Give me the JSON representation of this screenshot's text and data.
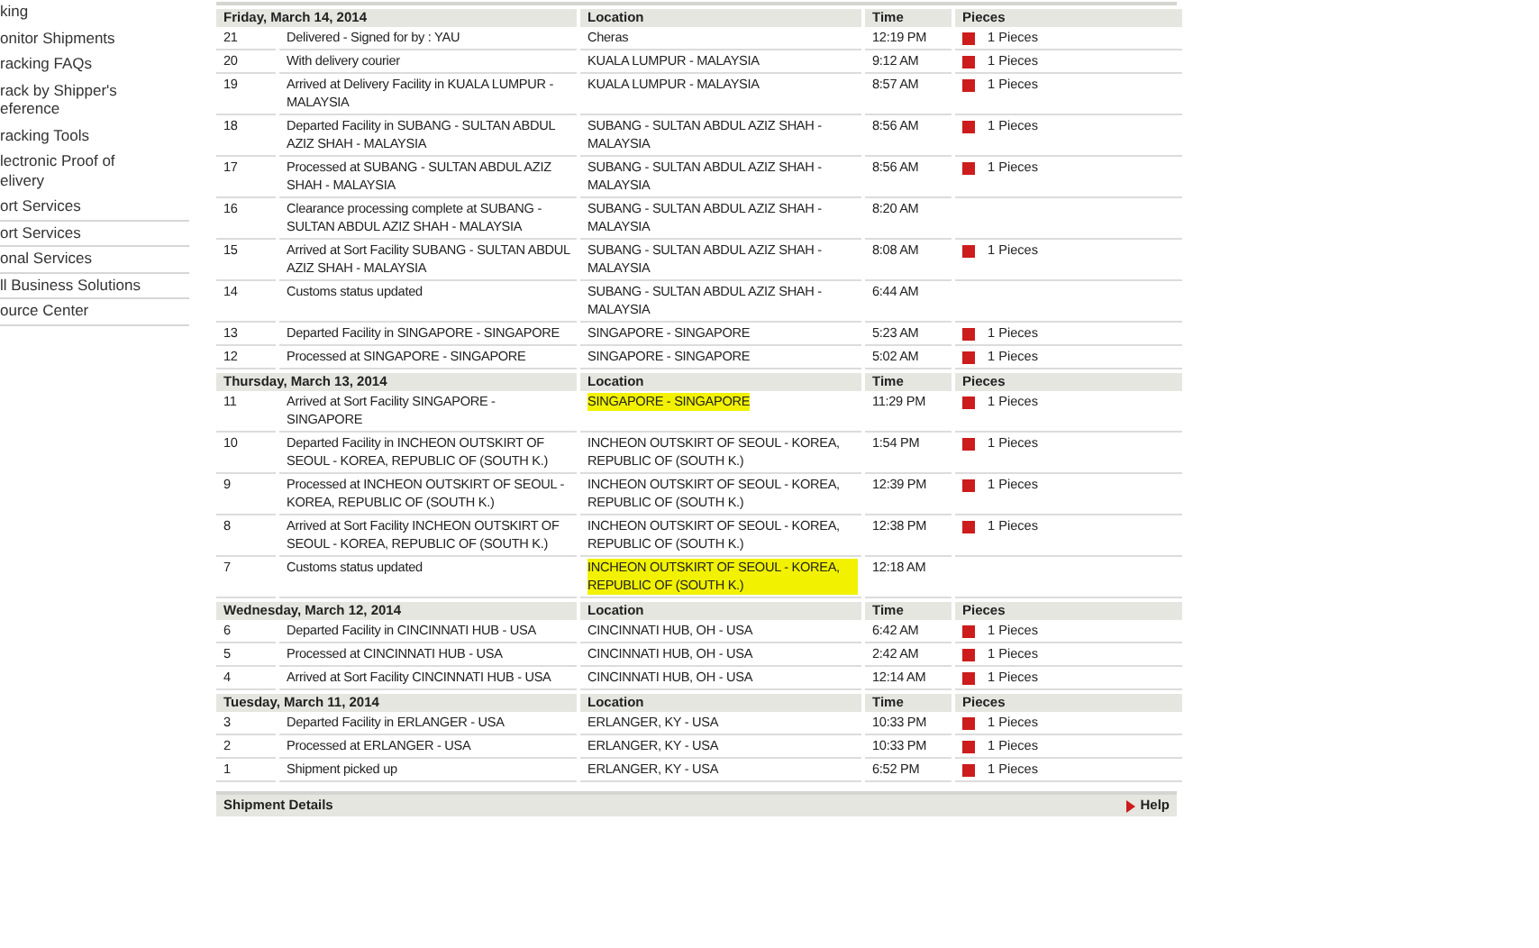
{
  "sidebar": {
    "items": [
      {
        "lines": [
          "king"
        ],
        "divider": false
      },
      {
        "lines": [
          "onitor Shipments"
        ],
        "divider": false
      },
      {
        "lines": [
          "racking FAQs"
        ],
        "divider": false
      },
      {
        "lines": [
          "rack by Shipper's",
          "eference"
        ],
        "divider": false
      },
      {
        "lines": [
          "racking Tools"
        ],
        "divider": false
      },
      {
        "lines": [
          "lectronic Proof of",
          "elivery"
        ],
        "divider": false
      },
      {
        "lines": [
          "ort Services"
        ],
        "divider": true
      },
      {
        "lines": [
          "ort Services"
        ],
        "divider": true
      },
      {
        "lines": [
          "onal Services"
        ],
        "divider": true
      },
      {
        "lines": [
          "ll Business Solutions"
        ],
        "divider": true
      },
      {
        "lines": [
          "ource Center"
        ],
        "divider": true
      }
    ]
  },
  "days": [
    {
      "date": "Friday, March 14, 2014",
      "columns": [
        "Location",
        "Time",
        "Pieces"
      ],
      "events": [
        {
          "number": "21",
          "description": "Delivered - Signed for by : YAU",
          "location": "Cheras",
          "highlighted": false,
          "time": "12:19 PM",
          "pieces": "1 Pieces"
        },
        {
          "number": "20",
          "description": "With delivery courier",
          "location": "KUALA LUMPUR - MALAYSIA",
          "highlighted": false,
          "time": "9:12 AM",
          "pieces": "1 Pieces"
        },
        {
          "number": "19",
          "description": "Arrived at Delivery Facility in KUALA LUMPUR - MALAYSIA",
          "location": "KUALA LUMPUR - MALAYSIA",
          "highlighted": false,
          "time": "8:57 AM",
          "pieces": "1 Pieces"
        },
        {
          "number": "18",
          "description": "Departed Facility in SUBANG - SULTAN ABDUL AZIZ SHAH - MALAYSIA",
          "location": "SUBANG - SULTAN ABDUL AZIZ SHAH - MALAYSIA",
          "highlighted": false,
          "time": "8:56 AM",
          "pieces": "1 Pieces"
        },
        {
          "number": "17",
          "description": "Processed at SUBANG - SULTAN ABDUL AZIZ SHAH - MALAYSIA",
          "location": "SUBANG - SULTAN ABDUL AZIZ SHAH - MALAYSIA",
          "highlighted": false,
          "time": "8:56 AM",
          "pieces": "1 Pieces"
        },
        {
          "number": "16",
          "description": "Clearance processing complete at SUBANG - SULTAN ABDUL AZIZ SHAH - MALAYSIA",
          "location": "SUBANG - SULTAN ABDUL AZIZ SHAH - MALAYSIA",
          "highlighted": false,
          "time": "8:20 AM"
        },
        {
          "number": "15",
          "description": "Arrived at Sort Facility SUBANG - SULTAN ABDUL AZIZ SHAH - MALAYSIA",
          "location": "SUBANG - SULTAN ABDUL AZIZ SHAH - MALAYSIA",
          "highlighted": false,
          "time": "8:08 AM",
          "pieces": "1 Pieces"
        },
        {
          "number": "14",
          "description": "Customs status updated",
          "location": "SUBANG - SULTAN ABDUL AZIZ SHAH - MALAYSIA",
          "highlighted": false,
          "time": "6:44 AM"
        },
        {
          "number": "13",
          "description": "Departed Facility in SINGAPORE - SINGAPORE",
          "location": "SINGAPORE - SINGAPORE",
          "highlighted": false,
          "time": "5:23 AM",
          "pieces": "1 Pieces"
        },
        {
          "number": "12",
          "description": "Processed at SINGAPORE - SINGAPORE",
          "location": "SINGAPORE - SINGAPORE",
          "highlighted": false,
          "time": "5:02 AM",
          "pieces": "1 Pieces"
        }
      ]
    },
    {
      "date": "Thursday, March 13, 2014",
      "columns": [
        "Location",
        "Time",
        "Pieces"
      ],
      "events": [
        {
          "number": "11",
          "description": "Arrived at Sort Facility SINGAPORE - SINGAPORE",
          "location": "SINGAPORE - SINGAPORE",
          "highlighted": true,
          "time": "11:29 PM",
          "pieces": "1 Pieces"
        },
        {
          "number": "10",
          "description": "Departed Facility in INCHEON OUTSKIRT OF SEOUL - KOREA, REPUBLIC OF (SOUTH K.)",
          "location": "INCHEON OUTSKIRT OF SEOUL - KOREA, REPUBLIC OF (SOUTH K.)",
          "highlighted": false,
          "time": "1:54 PM",
          "pieces": "1 Pieces"
        },
        {
          "number": "9",
          "description": "Processed at INCHEON OUTSKIRT OF SEOUL - KOREA, REPUBLIC OF (SOUTH K.)",
          "location": "INCHEON OUTSKIRT OF SEOUL - KOREA, REPUBLIC OF (SOUTH K.)",
          "highlighted": false,
          "time": "12:39 PM",
          "pieces": "1 Pieces"
        },
        {
          "number": "8",
          "description": "Arrived at Sort Facility INCHEON OUTSKIRT OF SEOUL - KOREA, REPUBLIC OF (SOUTH K.)",
          "location": "INCHEON OUTSKIRT OF SEOUL - KOREA, REPUBLIC OF (SOUTH K.)",
          "highlighted": false,
          "time": "12:38 PM",
          "pieces": "1 Pieces"
        },
        {
          "number": "7",
          "description": "Customs status updated",
          "location": "INCHEON OUTSKIRT OF SEOUL - KOREA, REPUBLIC OF (SOUTH K.)",
          "highlighted": true,
          "time": "12:18 AM"
        }
      ]
    },
    {
      "date": "Wednesday, March 12, 2014",
      "columns": [
        "Location",
        "Time",
        "Pieces"
      ],
      "events": [
        {
          "number": "6",
          "description": "Departed Facility in CINCINNATI HUB - USA",
          "location": "CINCINNATI HUB, OH - USA",
          "highlighted": false,
          "time": "6:42 AM",
          "pieces": "1 Pieces"
        },
        {
          "number": "5",
          "description": "Processed at CINCINNATI HUB - USA",
          "location": "CINCINNATI HUB, OH - USA",
          "highlighted": false,
          "time": "2:42 AM",
          "pieces": "1 Pieces"
        },
        {
          "number": "4",
          "description": "Arrived at Sort Facility CINCINNATI HUB - USA",
          "location": "CINCINNATI HUB, OH - USA",
          "highlighted": false,
          "time": "12:14 AM",
          "pieces": "1 Pieces"
        }
      ]
    },
    {
      "date": "Tuesday, March 11, 2014",
      "columns": [
        "Location",
        "Time",
        "Pieces"
      ],
      "events": [
        {
          "number": "3",
          "description": "Departed Facility in ERLANGER - USA",
          "location": "ERLANGER, KY - USA",
          "highlighted": false,
          "time": "10:33 PM",
          "pieces": "1 Pieces"
        },
        {
          "number": "2",
          "description": "Processed at ERLANGER - USA",
          "location": "ERLANGER, KY - USA",
          "highlighted": false,
          "time": "10:33 PM",
          "pieces": "1 Pieces"
        },
        {
          "number": "1",
          "description": "Shipment picked up",
          "location": "ERLANGER, KY - USA",
          "highlighted": false,
          "time": "6:52 PM",
          "pieces": "1 Pieces"
        }
      ]
    }
  ],
  "details_bar": {
    "title": "Shipment Details",
    "help": "Help"
  }
}
